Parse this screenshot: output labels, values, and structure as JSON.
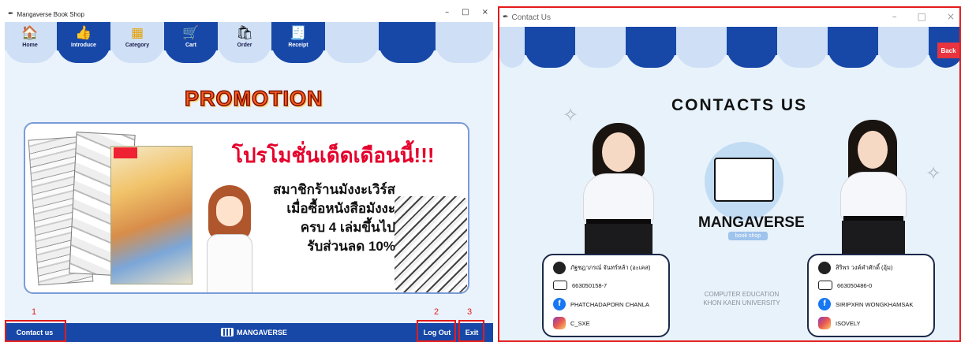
{
  "left_window": {
    "title": "Mangaverse Book Shop",
    "controls": [
      "–",
      "□",
      "×"
    ],
    "nav": [
      {
        "label": "Home",
        "icon": "home-icon",
        "glyph": "🏠"
      },
      {
        "label": "Introduce",
        "icon": "like-icon",
        "glyph": "👍"
      },
      {
        "label": "Category",
        "icon": "category-icon",
        "glyph": "▦"
      },
      {
        "label": "Cart",
        "icon": "cart-icon",
        "glyph": "🛒"
      },
      {
        "label": "Order",
        "icon": "order-icon",
        "glyph": "🛍"
      },
      {
        "label": "Receipt",
        "icon": "receipt-icon",
        "glyph": "🧾"
      }
    ],
    "promo_title": "PROMOTION",
    "banner": {
      "headline": "โปรโมชั่นเด็ดเดือนนี้!!!",
      "lines": [
        "สมาชิกร้านมังงะเวิร์ส",
        "เมื่อซื้อหนังสือมังงะ",
        "ครบ 4 เล่มขึ้นไป",
        "รับส่วนลด 10%"
      ]
    },
    "footer": {
      "contact": "Contact us",
      "logo": "MANGAVERSE",
      "logout": "Log Out",
      "exit": "Exit"
    },
    "markers": [
      "1",
      "2",
      "3"
    ]
  },
  "right_window": {
    "title": "Contact Us",
    "controls": [
      "–",
      "□",
      "×"
    ],
    "back": "Back",
    "heading": "CONTACTS US",
    "logo_word": "MANGAVERSE",
    "logo_sub": "book shop",
    "university": [
      "COMPUTER EDUCATION",
      "KHON KAEN UNIVERSITY"
    ],
    "people": [
      {
        "name": "ภัฐชฎาภรณ์ จันทร์หล้า (อะเคส)",
        "id": "663050158-7",
        "facebook": "PHATCHADAPORN CHANLA",
        "instagram": "C_SXE"
      },
      {
        "name": "สิริพร วงค์คำศักดิ์ (อุ้ม)",
        "id": "663050486-0",
        "facebook": "SIRIPXRN WONGKHAMSAK",
        "instagram": "ISOVELY"
      }
    ]
  },
  "colors": {
    "brand_blue": "#1748a8",
    "accent_red": "#e41b1b",
    "promo_orange": "#ff5a1f",
    "banner_red": "#e4002b"
  }
}
